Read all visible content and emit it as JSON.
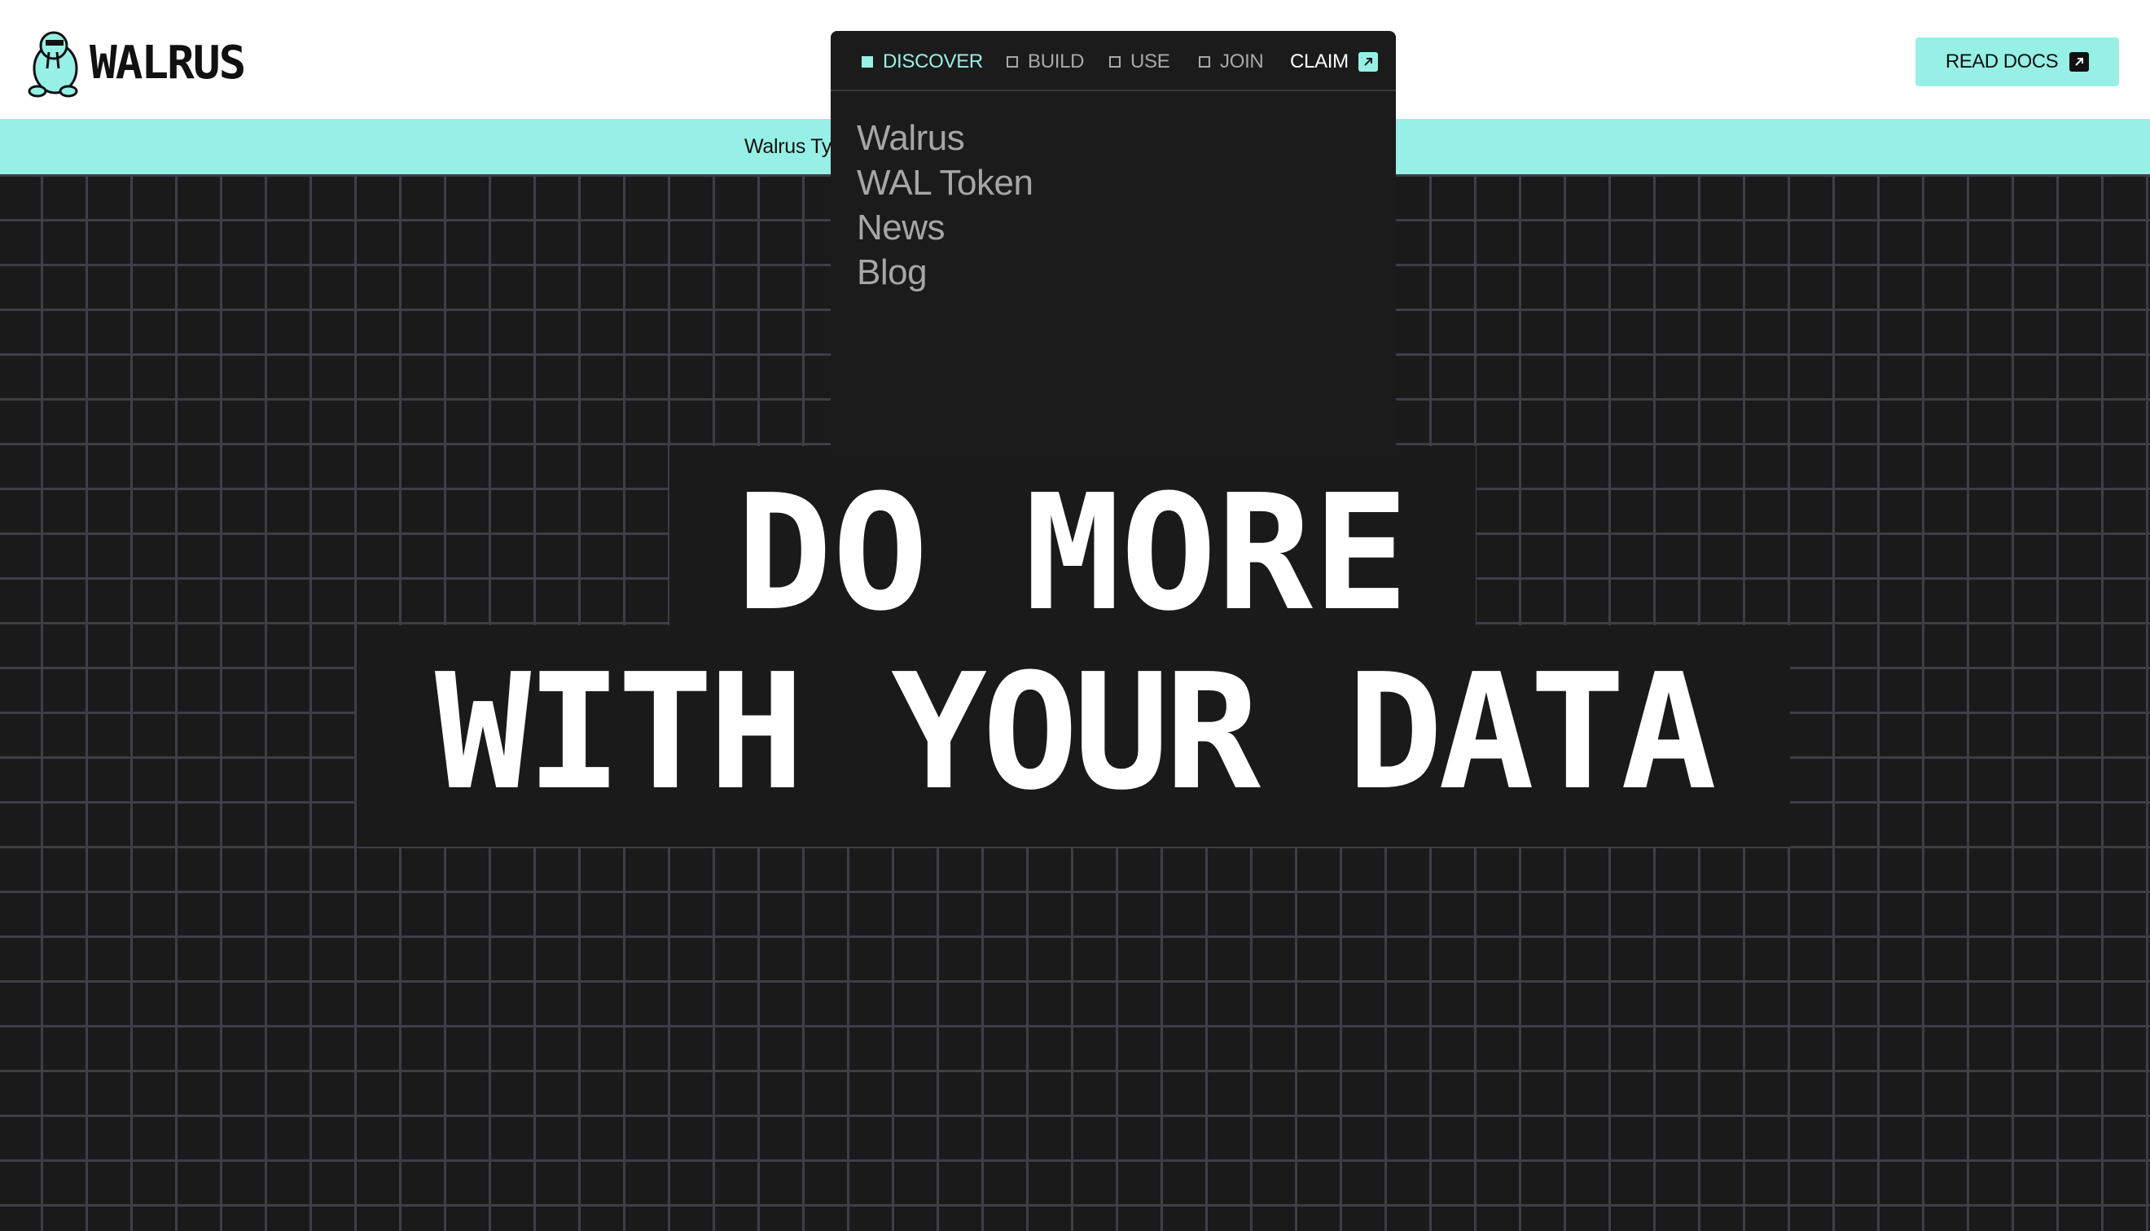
{
  "brand": {
    "name": "WALRUS"
  },
  "header": {
    "read_docs_label": "READ DOCS",
    "read_docs_icon": "arrow-up-right-icon"
  },
  "ticker": {
    "text": "Walrus Ty",
    "tail": "y"
  },
  "nav": {
    "items": [
      {
        "label": "DISCOVER",
        "active": true
      },
      {
        "label": "BUILD",
        "active": false
      },
      {
        "label": "USE",
        "active": false
      },
      {
        "label": "JOIN",
        "active": false
      }
    ],
    "claim_label": "CLAIM",
    "dropdown": [
      "Walrus",
      "WAL Token",
      "News",
      "Blog"
    ]
  },
  "hero": {
    "line1": "DO MORE",
    "line2": "WITH YOUR DATA"
  },
  "colors": {
    "accent": "#97f0e5",
    "background": "#1a1a1a",
    "grid": "#3e3e46"
  }
}
